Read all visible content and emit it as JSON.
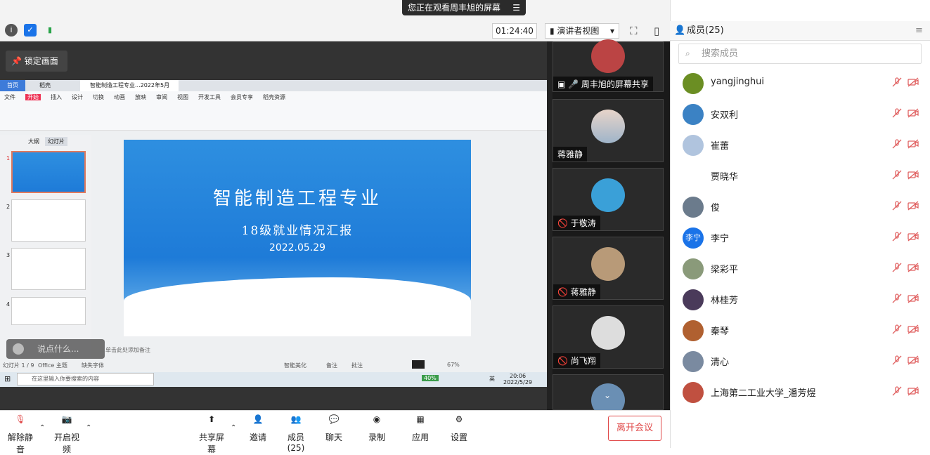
{
  "banner": {
    "text": "您正在观看周丰旭的屏幕"
  },
  "toolbar_top": {
    "timer": "01:24:40",
    "view": "演讲者视图"
  },
  "members_header": {
    "label": "成员(25)"
  },
  "search": {
    "placeholder": "搜索成员"
  },
  "lock": {
    "label": "锁定画面"
  },
  "slide": {
    "title": "智能制造工程专业",
    "subtitle": "18级就业情况汇报",
    "date": "2022.05.29"
  },
  "ppt": {
    "tabs": [
      "首页",
      "稻壳",
      "智能制造工程专业...2022年5月"
    ],
    "menu": [
      "文件",
      "开始",
      "插入",
      "设计",
      "切换",
      "动画",
      "放映",
      "审阅",
      "视图",
      "开发工具",
      "会员专享",
      "稻壳资源"
    ],
    "thumb_tabs": [
      "大纲",
      "幻灯片"
    ],
    "status_left": "幻灯片 1 / 9",
    "status_theme": "Office 主题",
    "status_font": "缺失字体",
    "note": "单击此处添加备注",
    "zoom": "67%",
    "smart": "智能美化",
    "remark": "备注",
    "annot": "批注"
  },
  "taskbar": {
    "search": "在这里输入你要搜索的内容",
    "time": "20:06",
    "date": "2022/5/29",
    "battery": "40%",
    "lang": "英"
  },
  "chat_input": {
    "placeholder": "说点什么..."
  },
  "video_tiles": [
    {
      "name": "周丰旭的屏幕共享"
    },
    {
      "name": "蒋雅静"
    },
    {
      "name": "于敬涛"
    },
    {
      "name": "蒋雅静"
    },
    {
      "name": "尚飞翔"
    }
  ],
  "members": [
    {
      "name": "yangjinghui",
      "avatar": "ant-icon"
    },
    {
      "name": "安双利",
      "avatar": "cartoon-icon"
    },
    {
      "name": "崔蕾",
      "avatar": "doraemon-icon"
    },
    {
      "name": "贾晓华",
      "avatar": "flower-icon"
    },
    {
      "name": "俊",
      "avatar": "landscape-icon"
    },
    {
      "name": "李宁",
      "avatar_text": "李宁"
    },
    {
      "name": "梁彩平",
      "avatar": "photo-icon"
    },
    {
      "name": "林桂芳",
      "avatar": "photo-icon"
    },
    {
      "name": "秦琴",
      "avatar": "sunset-icon"
    },
    {
      "name": "清心",
      "avatar": "photo-icon"
    },
    {
      "name": "上海第二工业大学_潘芳煜",
      "avatar": "photo-icon"
    }
  ],
  "bottom": {
    "mute": "解除静音",
    "video": "开启视频",
    "share": "共享屏幕",
    "invite": "邀请",
    "members": "成员(25)",
    "chat": "聊天",
    "record": "录制",
    "apps": "应用",
    "settings": "设置",
    "leave": "离开会议"
  },
  "colors": {
    "accent": "#1a73e8",
    "leave": "#e04848",
    "slide_blue": "#1e7bd8"
  }
}
